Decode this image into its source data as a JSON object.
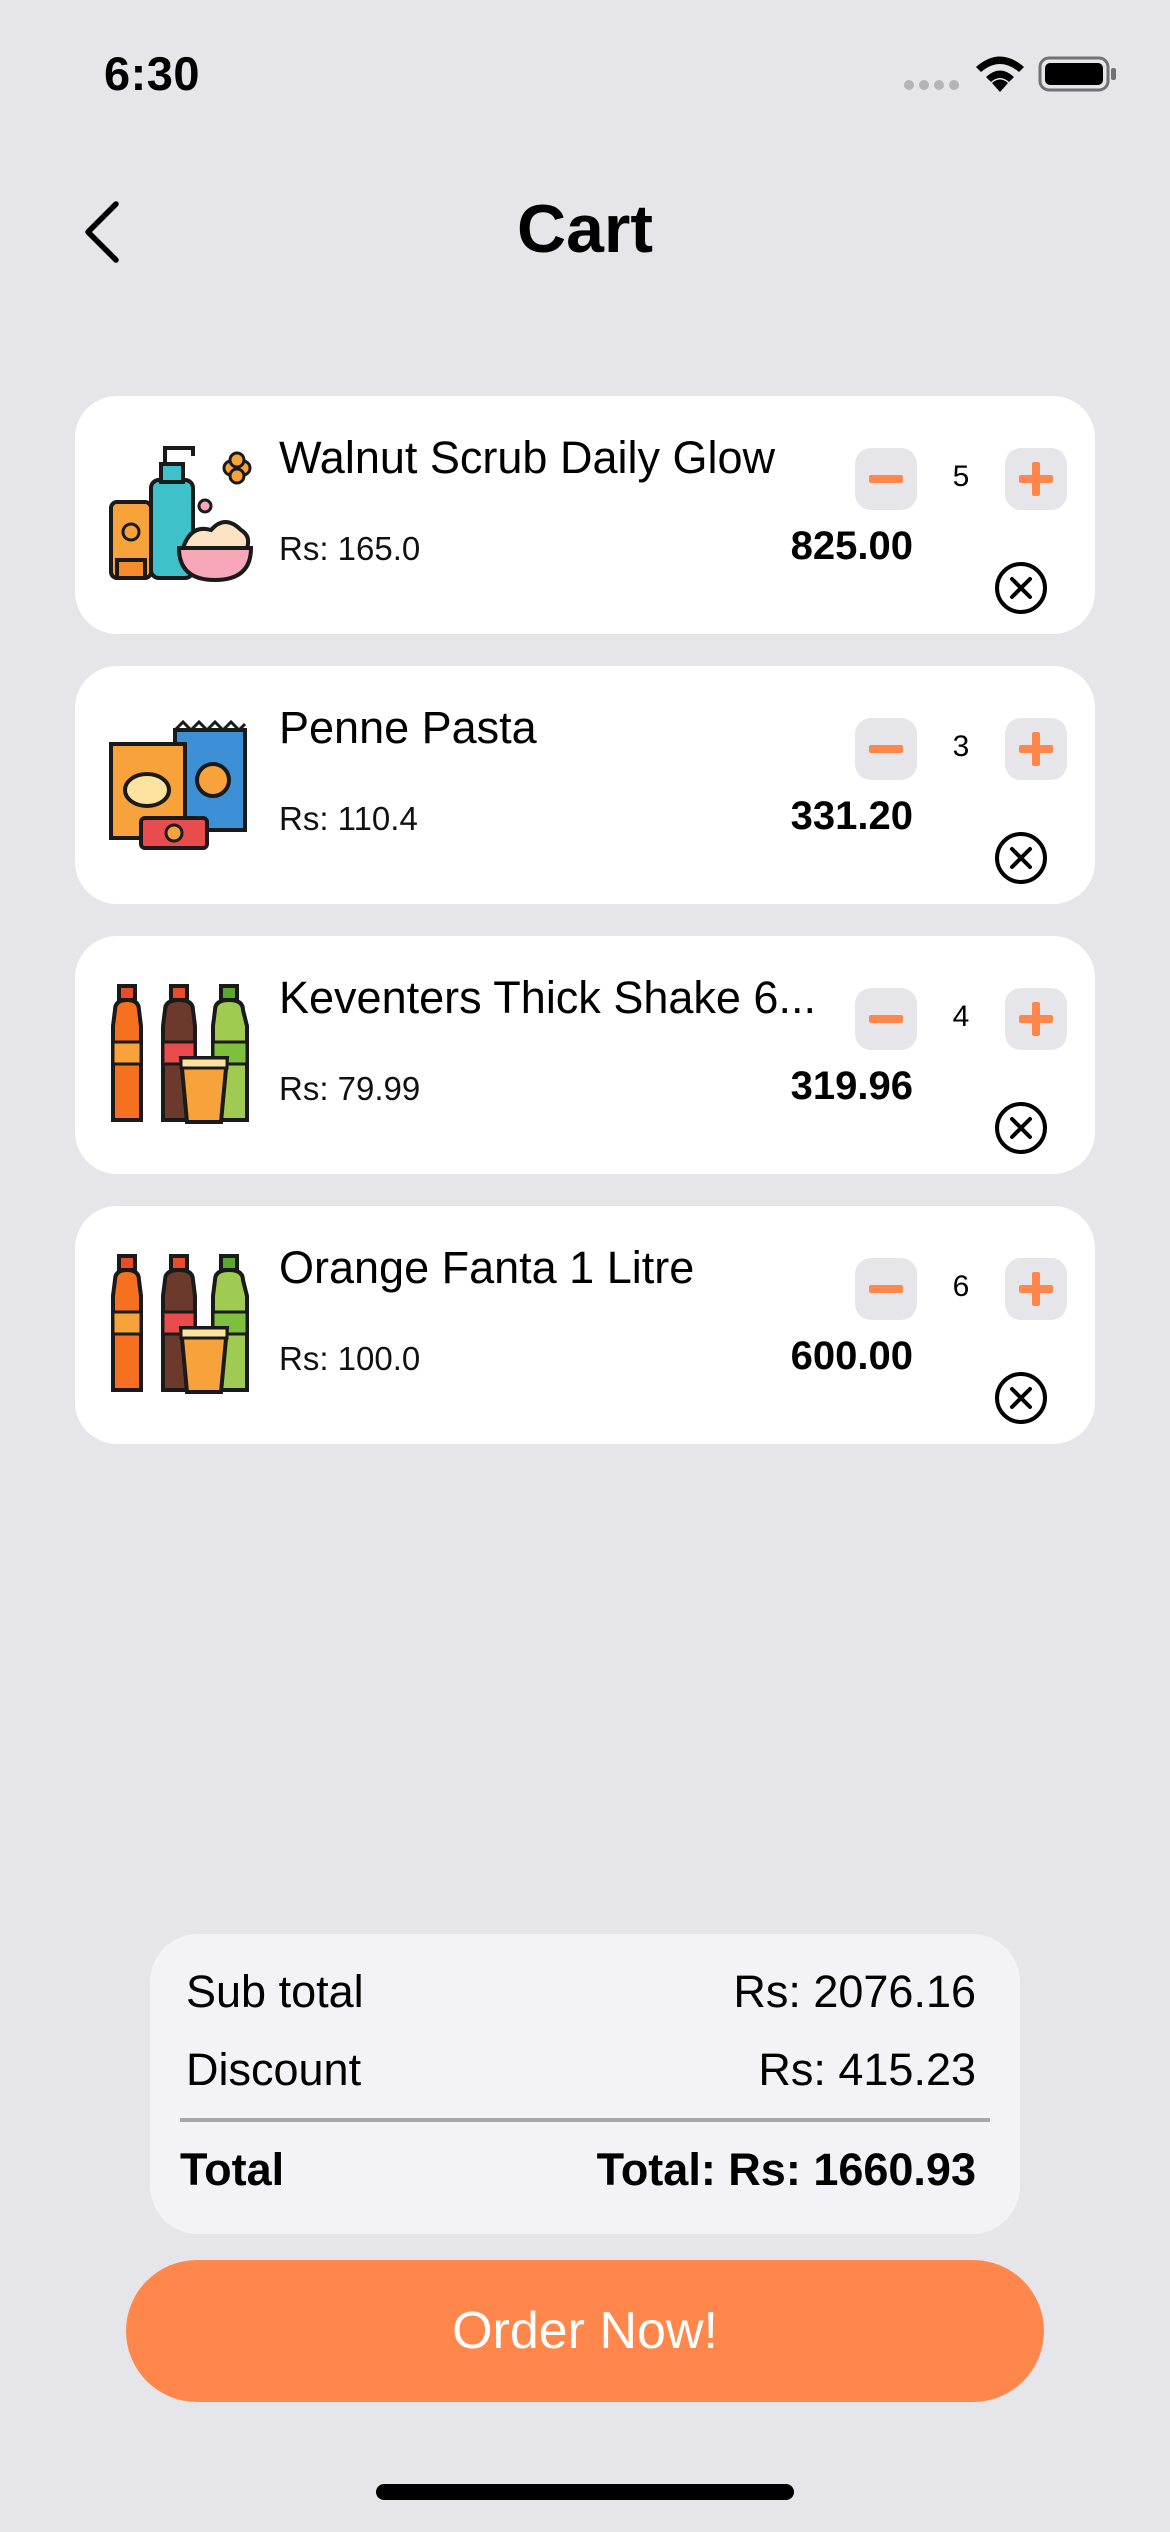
{
  "status_bar": {
    "time": "6:30"
  },
  "header": {
    "title": "Cart"
  },
  "cart": {
    "items": [
      {
        "name": "Walnut Scrub Daily Glow",
        "unit_price": "Rs: 165.0",
        "quantity": "5",
        "line_total": "825.00",
        "thumbnail": "cosmetics-icon"
      },
      {
        "name": "Penne Pasta",
        "unit_price": "Rs: 110.4",
        "quantity": "3",
        "line_total": "331.20",
        "thumbnail": "snacks-icon"
      },
      {
        "name": "Keventers Thick Shake 6...",
        "unit_price": "Rs: 79.99",
        "quantity": "4",
        "line_total": "319.96",
        "thumbnail": "soft-drinks-icon"
      },
      {
        "name": "Orange Fanta 1 Litre",
        "unit_price": "Rs: 100.0",
        "quantity": "6",
        "line_total": "600.00",
        "thumbnail": "soft-drinks-icon"
      }
    ]
  },
  "summary": {
    "subtotal_label": "Sub total",
    "subtotal_value": "Rs: 2076.16",
    "discount_label": "Discount",
    "discount_value": "Rs: 415.23",
    "total_label": "Total",
    "total_value": "Total: Rs: 1660.93"
  },
  "order_button": {
    "label": "Order Now!"
  },
  "colors": {
    "accent": "#ff874b",
    "background": "#e5e5ea",
    "card": "#ffffff",
    "summary_bg": "#f2f2f7"
  }
}
